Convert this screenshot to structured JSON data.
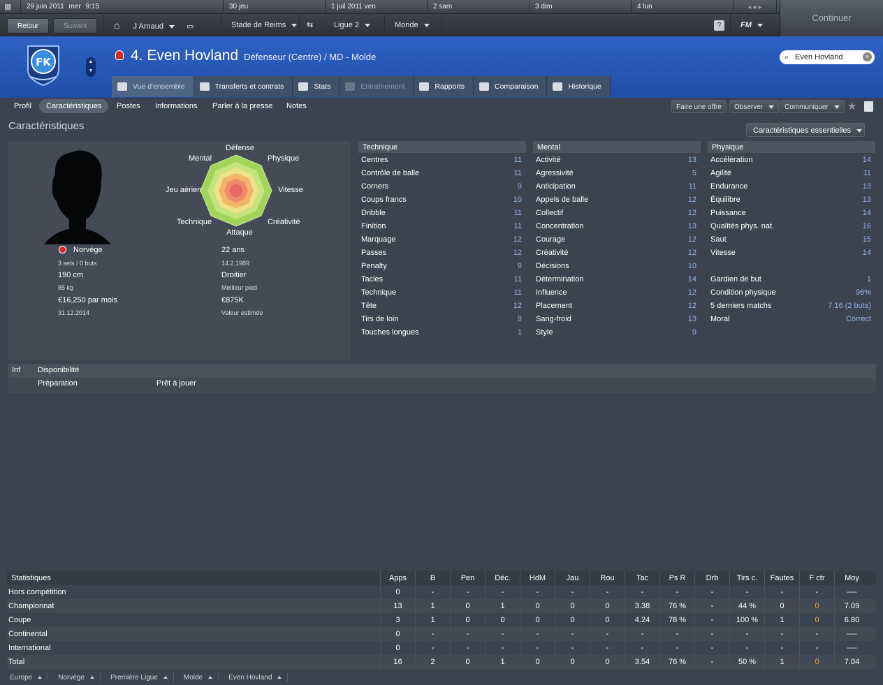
{
  "calendar": {
    "current": "29 juin 2011",
    "current_day": "mer",
    "time": "9:15",
    "days": [
      "30 jeu",
      "1 juil 2011 ven",
      "2 sam",
      "3 dim",
      "4 lun"
    ]
  },
  "nav": {
    "back": "Retour",
    "forward": "Suivant",
    "manager": "J Arnaud",
    "club": "Stade de Reims",
    "league": "Ligue 2",
    "world": "Monde",
    "help": "?",
    "fm": "FM",
    "continue": "Continuer"
  },
  "header": {
    "crest_text": "FK",
    "player_name": "4. Even Hovland",
    "player_position": "Défenseur (Centre) / MD - Molde",
    "search_value": "Even Hovland",
    "tabs": [
      "Vue d'ensemble",
      "Transferts et contrats",
      "Stats",
      "Entraînement",
      "Rapports",
      "Comparaison",
      "Historique"
    ]
  },
  "subnav": {
    "items": [
      "Profil",
      "Caractéristiques",
      "Postes",
      "Informations",
      "Parler à la presse",
      "Notes"
    ],
    "actions": [
      "Faire une offre",
      "Observer",
      "Communiquer"
    ]
  },
  "section": {
    "title": "Caractéristiques",
    "mode": "Caractéristiques essentielles"
  },
  "profile": {
    "nationality": "Norvège",
    "caps": "3 sels / 0 buts",
    "height": "190 cm",
    "weight": "85 kg",
    "wage": "€16,250 par mois",
    "contract_end": "31.12.2014",
    "age": "22 ans",
    "dob": "14.2.1989",
    "foot": "Droitier",
    "foot_label": "Meilleur pied",
    "value": "€875K",
    "value_label": "Valeur estimée"
  },
  "radar": {
    "labels": [
      "Défense",
      "Physique",
      "Vitesse",
      "Créativité",
      "Attaque",
      "Technique",
      "Jeu aérien",
      "Mental"
    ]
  },
  "technique": {
    "title": "Technique",
    "rows": [
      {
        "name": "Centres",
        "value": "11"
      },
      {
        "name": "Contrôle de balle",
        "value": "11"
      },
      {
        "name": "Corners",
        "value": "9"
      },
      {
        "name": "Coups francs",
        "value": "10"
      },
      {
        "name": "Dribble",
        "value": "11"
      },
      {
        "name": "Finition",
        "value": "11"
      },
      {
        "name": "Marquage",
        "value": "12"
      },
      {
        "name": "Passes",
        "value": "12"
      },
      {
        "name": "Penalty",
        "value": "9"
      },
      {
        "name": "Tacles",
        "value": "11"
      },
      {
        "name": "Technique",
        "value": "11"
      },
      {
        "name": "Tête",
        "value": "12"
      },
      {
        "name": "Tirs de loin",
        "value": "9"
      },
      {
        "name": "Touches longues",
        "value": "1"
      }
    ]
  },
  "mental": {
    "title": "Mental",
    "rows": [
      {
        "name": "Activité",
        "value": "13"
      },
      {
        "name": "Agressivité",
        "value": "5"
      },
      {
        "name": "Anticipation",
        "value": "11"
      },
      {
        "name": "Appels de balle",
        "value": "12"
      },
      {
        "name": "Collectif",
        "value": "12"
      },
      {
        "name": "Concentration",
        "value": "13"
      },
      {
        "name": "Courage",
        "value": "12"
      },
      {
        "name": "Créativité",
        "value": "12"
      },
      {
        "name": "Décisions",
        "value": "10"
      },
      {
        "name": "Détermination",
        "value": "14"
      },
      {
        "name": "Influence",
        "value": "12"
      },
      {
        "name": "Placement",
        "value": "12"
      },
      {
        "name": "Sang-froid",
        "value": "13"
      },
      {
        "name": "Style",
        "value": "9"
      }
    ]
  },
  "physique": {
    "title": "Physique",
    "rows": [
      {
        "name": "Accélération",
        "value": "14"
      },
      {
        "name": "Agilité",
        "value": "11"
      },
      {
        "name": "Endurance",
        "value": "13"
      },
      {
        "name": "Équilibre",
        "value": "13"
      },
      {
        "name": "Puissance",
        "value": "14"
      },
      {
        "name": "Qualités phys. nat.",
        "value": "16"
      },
      {
        "name": "Saut",
        "value": "15"
      },
      {
        "name": "Vitesse",
        "value": "14"
      }
    ],
    "extra": [
      {
        "name": "Gardien de but",
        "value": "1"
      },
      {
        "name": "Condition physique",
        "value": "96%"
      },
      {
        "name": "5 derniers matchs",
        "value": "7.16 (2 buts)"
      },
      {
        "name": "Moral",
        "value": "Correct"
      }
    ]
  },
  "availability": {
    "col1": "Inf",
    "col2": "Disponibilité",
    "row_label": "Préparation",
    "row_value": "Prêt à jouer"
  },
  "stats": {
    "title": "Statistiques",
    "columns": [
      "Apps",
      "B",
      "Pen",
      "Déc.",
      "HdM",
      "Jau",
      "Rou",
      "Tac",
      "Ps R",
      "Drb",
      "Tirs c.",
      "Fautes",
      "F ctr",
      "Moy"
    ],
    "rows": [
      {
        "label": "Hors compétition",
        "values": [
          "0",
          "-",
          "-",
          "-",
          "-",
          "-",
          "-",
          "-",
          "-",
          "-",
          "-",
          "-",
          "-",
          "----"
        ]
      },
      {
        "label": "Championnat",
        "values": [
          "13",
          "1",
          "0",
          "1",
          "0",
          "0",
          "0",
          "3.38",
          "76 %",
          "-",
          "44 %",
          "0",
          "0",
          "7.09"
        ]
      },
      {
        "label": "Coupe",
        "values": [
          "3",
          "1",
          "0",
          "0",
          "0",
          "0",
          "0",
          "4.24",
          "78 %",
          "-",
          "100 %",
          "1",
          "0",
          "6.80"
        ]
      },
      {
        "label": "Continental",
        "values": [
          "0",
          "-",
          "-",
          "-",
          "-",
          "-",
          "-",
          "-",
          "-",
          "-",
          "-",
          "-",
          "-",
          "----"
        ]
      },
      {
        "label": "International",
        "values": [
          "0",
          "-",
          "-",
          "-",
          "-",
          "-",
          "-",
          "-",
          "-",
          "-",
          "-",
          "-",
          "-",
          "----"
        ]
      },
      {
        "label": "Total",
        "values": [
          "16",
          "2",
          "0",
          "1",
          "0",
          "0",
          "0",
          "3.54",
          "76 %",
          "-",
          "50 %",
          "1",
          "0",
          "7.04"
        ]
      }
    ]
  },
  "breadcrumbs": [
    "Europe",
    "Norvège",
    "Première Ligue",
    "Molde",
    "Even Hovland"
  ]
}
